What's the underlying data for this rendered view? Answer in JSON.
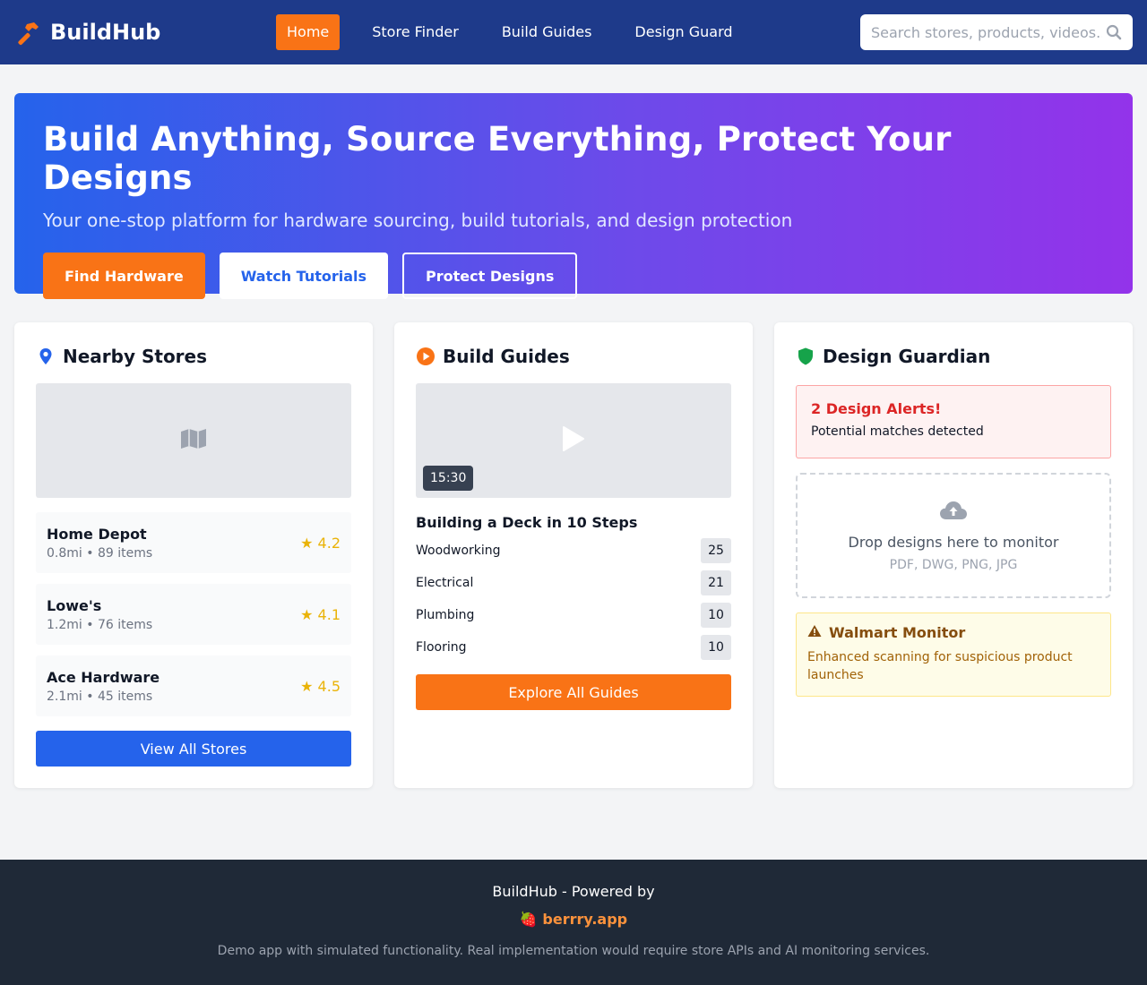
{
  "brand": {
    "name": "BuildHub",
    "accent": "#f97316",
    "header_bg": "#1e3a8a"
  },
  "nav": {
    "items": [
      {
        "label": "Home",
        "active": true
      },
      {
        "label": "Store Finder",
        "active": false
      },
      {
        "label": "Build Guides",
        "active": false
      },
      {
        "label": "Design Guard",
        "active": false
      }
    ]
  },
  "search": {
    "placeholder": "Search stores, products, videos...",
    "value": ""
  },
  "hero": {
    "title": "Build Anything, Source Everything, Protect Your Designs",
    "subtitle": "Your one-stop platform for hardware sourcing, build tutorials, and design protection",
    "buttons": [
      "Find Hardware",
      "Watch Tutorials",
      "Protect Designs"
    ]
  },
  "stores": {
    "title": "Nearby Stores",
    "items": [
      {
        "name": "Home Depot",
        "meta": "0.8mi • 89 items",
        "rating": "★ 4.2"
      },
      {
        "name": "Lowe's",
        "meta": "1.2mi • 76 items",
        "rating": "★ 4.1"
      },
      {
        "name": "Ace Hardware",
        "meta": "2.1mi • 45 items",
        "rating": "★ 4.5"
      }
    ],
    "button": "View All Stores"
  },
  "guides": {
    "title": "Build Guides",
    "duration": "15:30",
    "video_title": "Building a Deck in 10 Steps",
    "categories": [
      {
        "name": "Woodworking",
        "count": "25"
      },
      {
        "name": "Electrical",
        "count": "21"
      },
      {
        "name": "Plumbing",
        "count": "10"
      },
      {
        "name": "Flooring",
        "count": "10"
      }
    ],
    "button": "Explore All Guides"
  },
  "guardian": {
    "title": "Design Guardian",
    "alert_title": "2 Design Alerts!",
    "alert_sub": "Potential matches detected",
    "drop_text": "Drop designs here to monitor",
    "drop_formats": "PDF, DWG, PNG, JPG",
    "monitor_title": "Walmart Monitor",
    "monitor_text": "Enhanced scanning for suspicious product launches"
  },
  "footer": {
    "line1": "BuildHub - Powered by",
    "line2": "🍓 berrry.app",
    "line3": "Demo app with simulated functionality. Real implementation would require store APIs and AI monitoring services."
  }
}
